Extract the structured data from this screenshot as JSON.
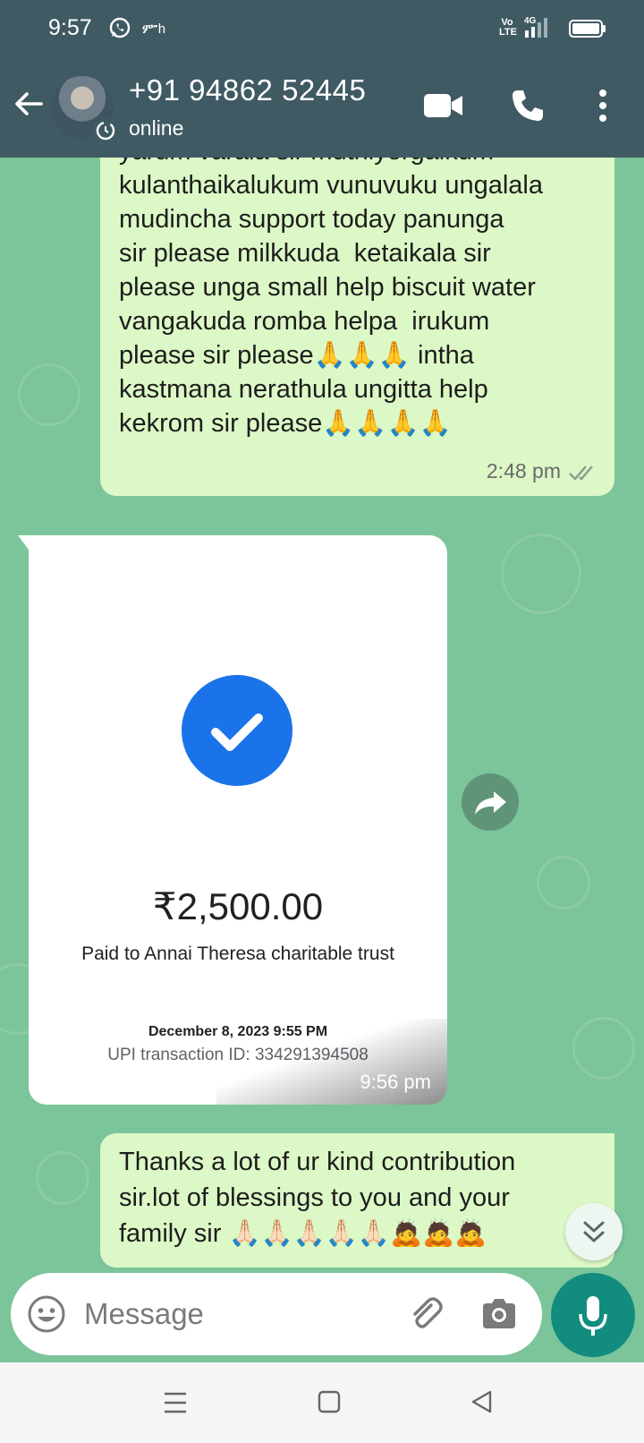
{
  "status_bar": {
    "time": "9:57",
    "carrier_glyph": "ᎃh",
    "volte": "Vo\nLTE",
    "network": "4G",
    "icons": [
      "whatsapp-icon",
      "signal-icon",
      "battery-icon"
    ]
  },
  "header": {
    "contact_name": "+91 94862 52445",
    "status": "online",
    "icons": [
      "back-arrow-icon",
      "video-call-icon",
      "phone-icon",
      "more-vert-icon"
    ]
  },
  "messages": [
    {
      "direction": "outgoing",
      "text": "yarum varala sir muthiyorgalkum\nkulanthaikalukum vunuvuku ungalala\nmudincha support today panunga\nsir please milkkuda  ketaikala sir\nplease unga small help biscuit water\nvangakuda romba helpa  irukum\nplease sir please🙏🙏🙏 intha\nkastmana nerathula ungitta help\nkekrom sir please🙏🙏🙏🙏",
      "time": "2:48 pm",
      "status": "read"
    },
    {
      "direction": "incoming",
      "type": "image",
      "payment": {
        "amount": "₹2,500.00",
        "paid_to": "Paid to Annai Theresa charitable trust",
        "date": "December 8, 2023 9:55 PM",
        "transaction_id": "UPI transaction ID: 334291394508"
      },
      "time": "9:56 pm"
    },
    {
      "direction": "outgoing",
      "text": "Thanks a lot of ur kind contribution\nsir.lot of blessings to you and your\nfamily sir 🙏🏻🙏🏻🙏🏻🙏🏻🙏🏻🙇🙇🙇"
    }
  ],
  "composer": {
    "placeholder": "Message",
    "value": ""
  },
  "colors": {
    "header_bg": "#3f5a63",
    "chat_bg": "#7cc49a",
    "outgoing_bubble": "#dcf8c6",
    "accent": "#128c7e",
    "pay_check": "#1a73e8"
  }
}
